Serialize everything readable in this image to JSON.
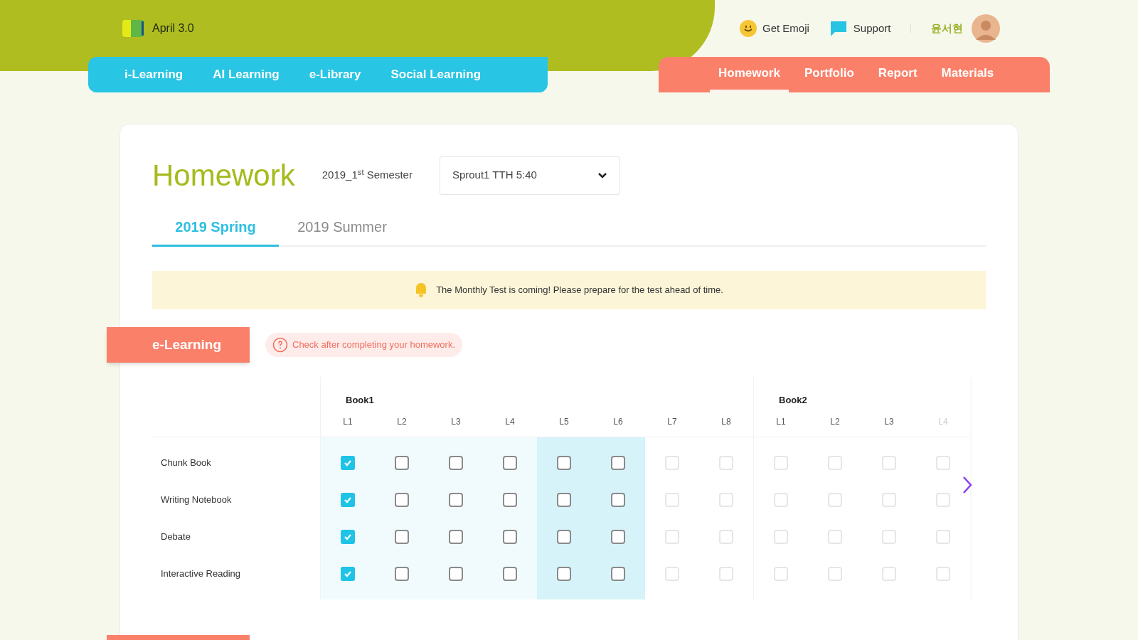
{
  "logo": {
    "text": "April 3.0"
  },
  "top_links": [
    {
      "kind": "emoji",
      "label": "Get Emoji"
    },
    {
      "kind": "support",
      "label": "Support"
    }
  ],
  "user": {
    "name": "윤서현"
  },
  "main_nav": [
    {
      "label": "i-Learning"
    },
    {
      "label": "AI Learning"
    },
    {
      "label": "e-Library"
    },
    {
      "label": "Social Learning"
    }
  ],
  "sub_nav": [
    {
      "label": "Homework",
      "selected": true
    },
    {
      "label": "Portfolio",
      "selected": false
    },
    {
      "label": "Report",
      "selected": false
    },
    {
      "label": "Materials",
      "selected": false
    }
  ],
  "page": {
    "title": "Homework",
    "semester": "2019_1$^{st}$ Semester",
    "class_select": {
      "value": "Sprout1 TTH 5:40"
    }
  },
  "tabs": [
    {
      "label": "2019 Spring",
      "selected": true
    },
    {
      "label": "2019 Summer",
      "selected": false
    }
  ],
  "notice": {
    "text": "The Monthly Test is coming! Please prepare for the test ahead of time."
  },
  "section": {
    "title": "e-Learning",
    "hint": "Check after completing your homework."
  },
  "books": [
    {
      "title": "Book1",
      "lessons": [
        {
          "label": "L1",
          "current": false,
          "disabled": false
        },
        {
          "label": "L2",
          "current": false,
          "disabled": false
        },
        {
          "label": "L3",
          "current": false,
          "disabled": false
        },
        {
          "label": "L4",
          "current": false,
          "disabled": false
        },
        {
          "label": "L5",
          "current": true,
          "disabled": false
        },
        {
          "label": "L6",
          "current": true,
          "disabled": false
        },
        {
          "label": "L7",
          "current": false,
          "disabled": true
        },
        {
          "label": "L8",
          "current": false,
          "disabled": true
        }
      ]
    },
    {
      "title": "Book2",
      "lessons": [
        {
          "label": "L1",
          "current": false,
          "disabled": true
        },
        {
          "label": "L2",
          "current": false,
          "disabled": true
        },
        {
          "label": "L3",
          "current": false,
          "disabled": true
        },
        {
          "label": "L4",
          "current": false,
          "disabled": true
        }
      ]
    }
  ],
  "rows": [
    {
      "label": "Chunk Book",
      "checks": [
        [
          true,
          false,
          false,
          false,
          false,
          false,
          false,
          false
        ],
        [
          false,
          false,
          false,
          false
        ]
      ]
    },
    {
      "label": "Writing Notebook",
      "checks": [
        [
          true,
          false,
          false,
          false,
          false,
          false,
          false,
          false
        ],
        [
          false,
          false,
          false,
          false
        ]
      ]
    },
    {
      "label": "Debate",
      "checks": [
        [
          true,
          false,
          false,
          false,
          false,
          false,
          false,
          false
        ],
        [
          false,
          false,
          false,
          false
        ]
      ]
    },
    {
      "label": "Interactive Reading",
      "checks": [
        [
          true,
          false,
          false,
          false,
          false,
          false,
          false,
          false
        ],
        [
          false,
          false,
          false,
          false
        ]
      ]
    }
  ]
}
